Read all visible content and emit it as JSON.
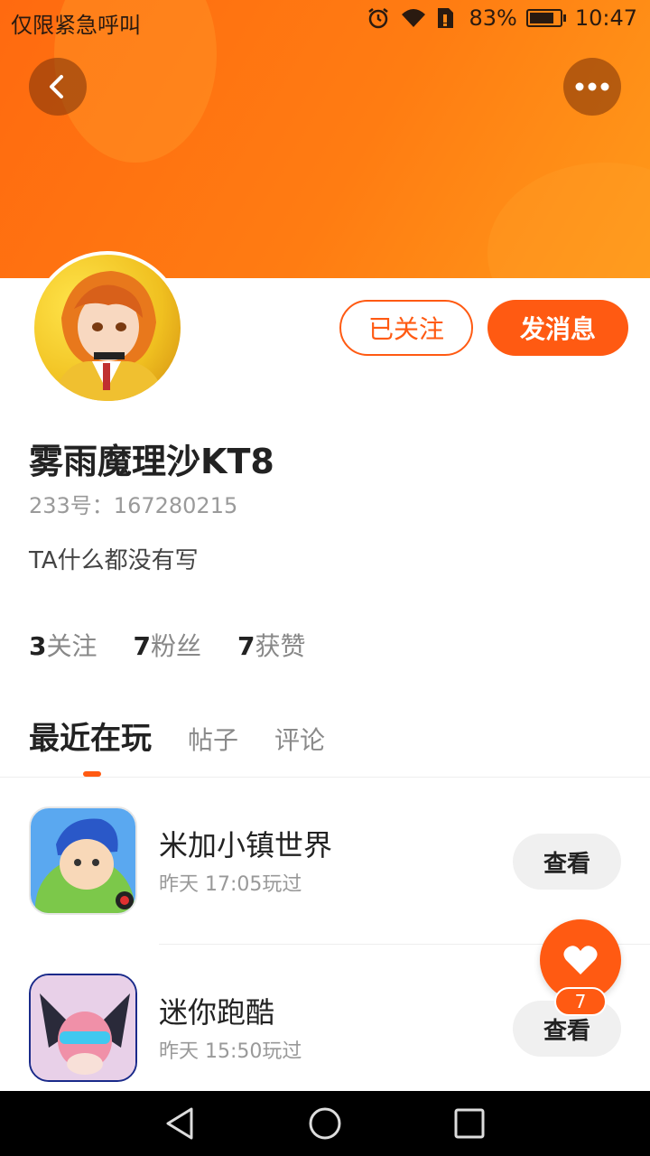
{
  "status_bar": {
    "carrier_text": "仅限紧急呼叫",
    "battery_text": "83%",
    "battery_level": 0.83,
    "time": "10:47",
    "icons": [
      "alarm-icon",
      "wifi-icon",
      "sim-icon",
      "battery-icon"
    ]
  },
  "header": {
    "back_icon": "chevron-left-icon",
    "more_icon": "more-dots-icon"
  },
  "profile": {
    "follow_label": "已关注",
    "message_label": "发消息",
    "username": "雾雨魔理沙KT8",
    "id_text": "233号：167280215",
    "bio": "TA什么都没有写",
    "stats": [
      {
        "count": "3",
        "label": "关注"
      },
      {
        "count": "7",
        "label": "粉丝"
      },
      {
        "count": "7",
        "label": "获赞"
      }
    ]
  },
  "tabs": [
    {
      "label": "最近在玩",
      "active": true
    },
    {
      "label": "帖子",
      "active": false
    },
    {
      "label": "评论",
      "active": false
    }
  ],
  "games": [
    {
      "name": "米加小镇世界",
      "time": "昨天 17:05玩过",
      "button": "查看"
    },
    {
      "name": "迷你跑酷",
      "time": "昨天 15:50玩过",
      "button": "查看"
    }
  ],
  "like_fab": {
    "icon": "heart-icon",
    "count": "7"
  },
  "nav_bar": {
    "icons": [
      "back-triangle-icon",
      "home-circle-icon",
      "recents-square-icon"
    ]
  },
  "colors": {
    "accent": "#ff5a12",
    "banner": "#ff7c12"
  }
}
